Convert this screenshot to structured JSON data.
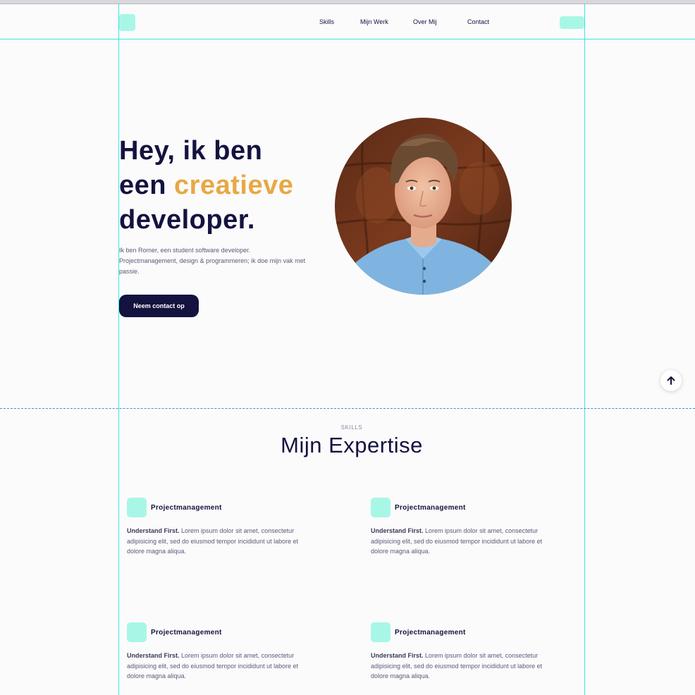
{
  "nav": {
    "items": [
      "Skills",
      "Mijn Werk",
      "Over Mij",
      "Contact"
    ]
  },
  "hero": {
    "title_line1": "Hey, ik ben",
    "title_line2_prefix": "een",
    "title_accent": "creatieve",
    "title_line3": "developer.",
    "intro": "Ik ben Romer, een student software developer. Projectmanagement, design & programmeren; ik doe mijn vak met passie.",
    "cta": "Neem contact op"
  },
  "skills_section": {
    "kicker": "SKILLS",
    "title": "Mijn Expertise",
    "cards": [
      {
        "title": "Projectmanagement",
        "lead": "Understand First.",
        "text": "Lorem ipsum dolor sit amet, consectetur adipisicing elit, sed do eiusmod tempor incididunt ut labore et dolore magna aliqua."
      },
      {
        "title": "Projectmanagement",
        "lead": "Understand First.",
        "text": "Lorem ipsum dolor sit amet, consectetur adipisicing elit, sed do eiusmod tempor incididunt ut labore et dolore magna aliqua."
      },
      {
        "title": "Projectmanagement",
        "lead": "Understand First.",
        "text": "Lorem ipsum dolor sit amet, consectetur adipisicing elit, sed do eiusmod tempor incididunt ut labore et dolore magna aliqua."
      },
      {
        "title": "Projectmanagement",
        "lead": "Understand First.",
        "text": "Lorem ipsum dolor sit amet, consectetur adipisicing elit, sed do eiusmod tempor incididunt ut labore et dolore magna aliqua."
      }
    ]
  },
  "colors": {
    "navy": "#14123f",
    "accent": "#e8a844",
    "mint": "#a8f7e6",
    "guide": "#3fe3e3"
  },
  "icons": {
    "scroll_top": "arrow-up-icon"
  }
}
